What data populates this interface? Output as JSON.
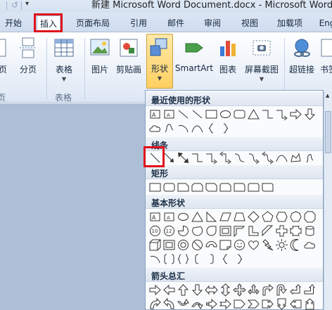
{
  "window": {
    "title": "新建 Microsoft Word Document.docx - Microsoft Word"
  },
  "tabs": [
    "开始",
    "插入",
    "页面布局",
    "引用",
    "邮件",
    "审阅",
    "视图",
    "加载项",
    "Eng"
  ],
  "active_tab": "插入",
  "ribbon": {
    "buttons": {
      "page": "页",
      "page_break": "分页",
      "table": "表格",
      "picture": "图片",
      "clipart": "剪贴画",
      "shapes": "形状",
      "smartart": "SmartArt",
      "chart": "图表",
      "screenshot": "屏幕截图",
      "hyperlink": "超链接",
      "bookmark": "书签"
    },
    "group_labels": {
      "pages": "页",
      "tables": "表格"
    }
  },
  "gallery": {
    "sections": {
      "recent": "最近使用的形状",
      "lines": "线条",
      "rectangles": "矩形",
      "basic": "基本形状",
      "arrows": "箭头总汇"
    }
  },
  "colors": {
    "highlight": "#e0101c",
    "active_button": "#ffd061",
    "ribbon_blue": "#dde7f4"
  }
}
